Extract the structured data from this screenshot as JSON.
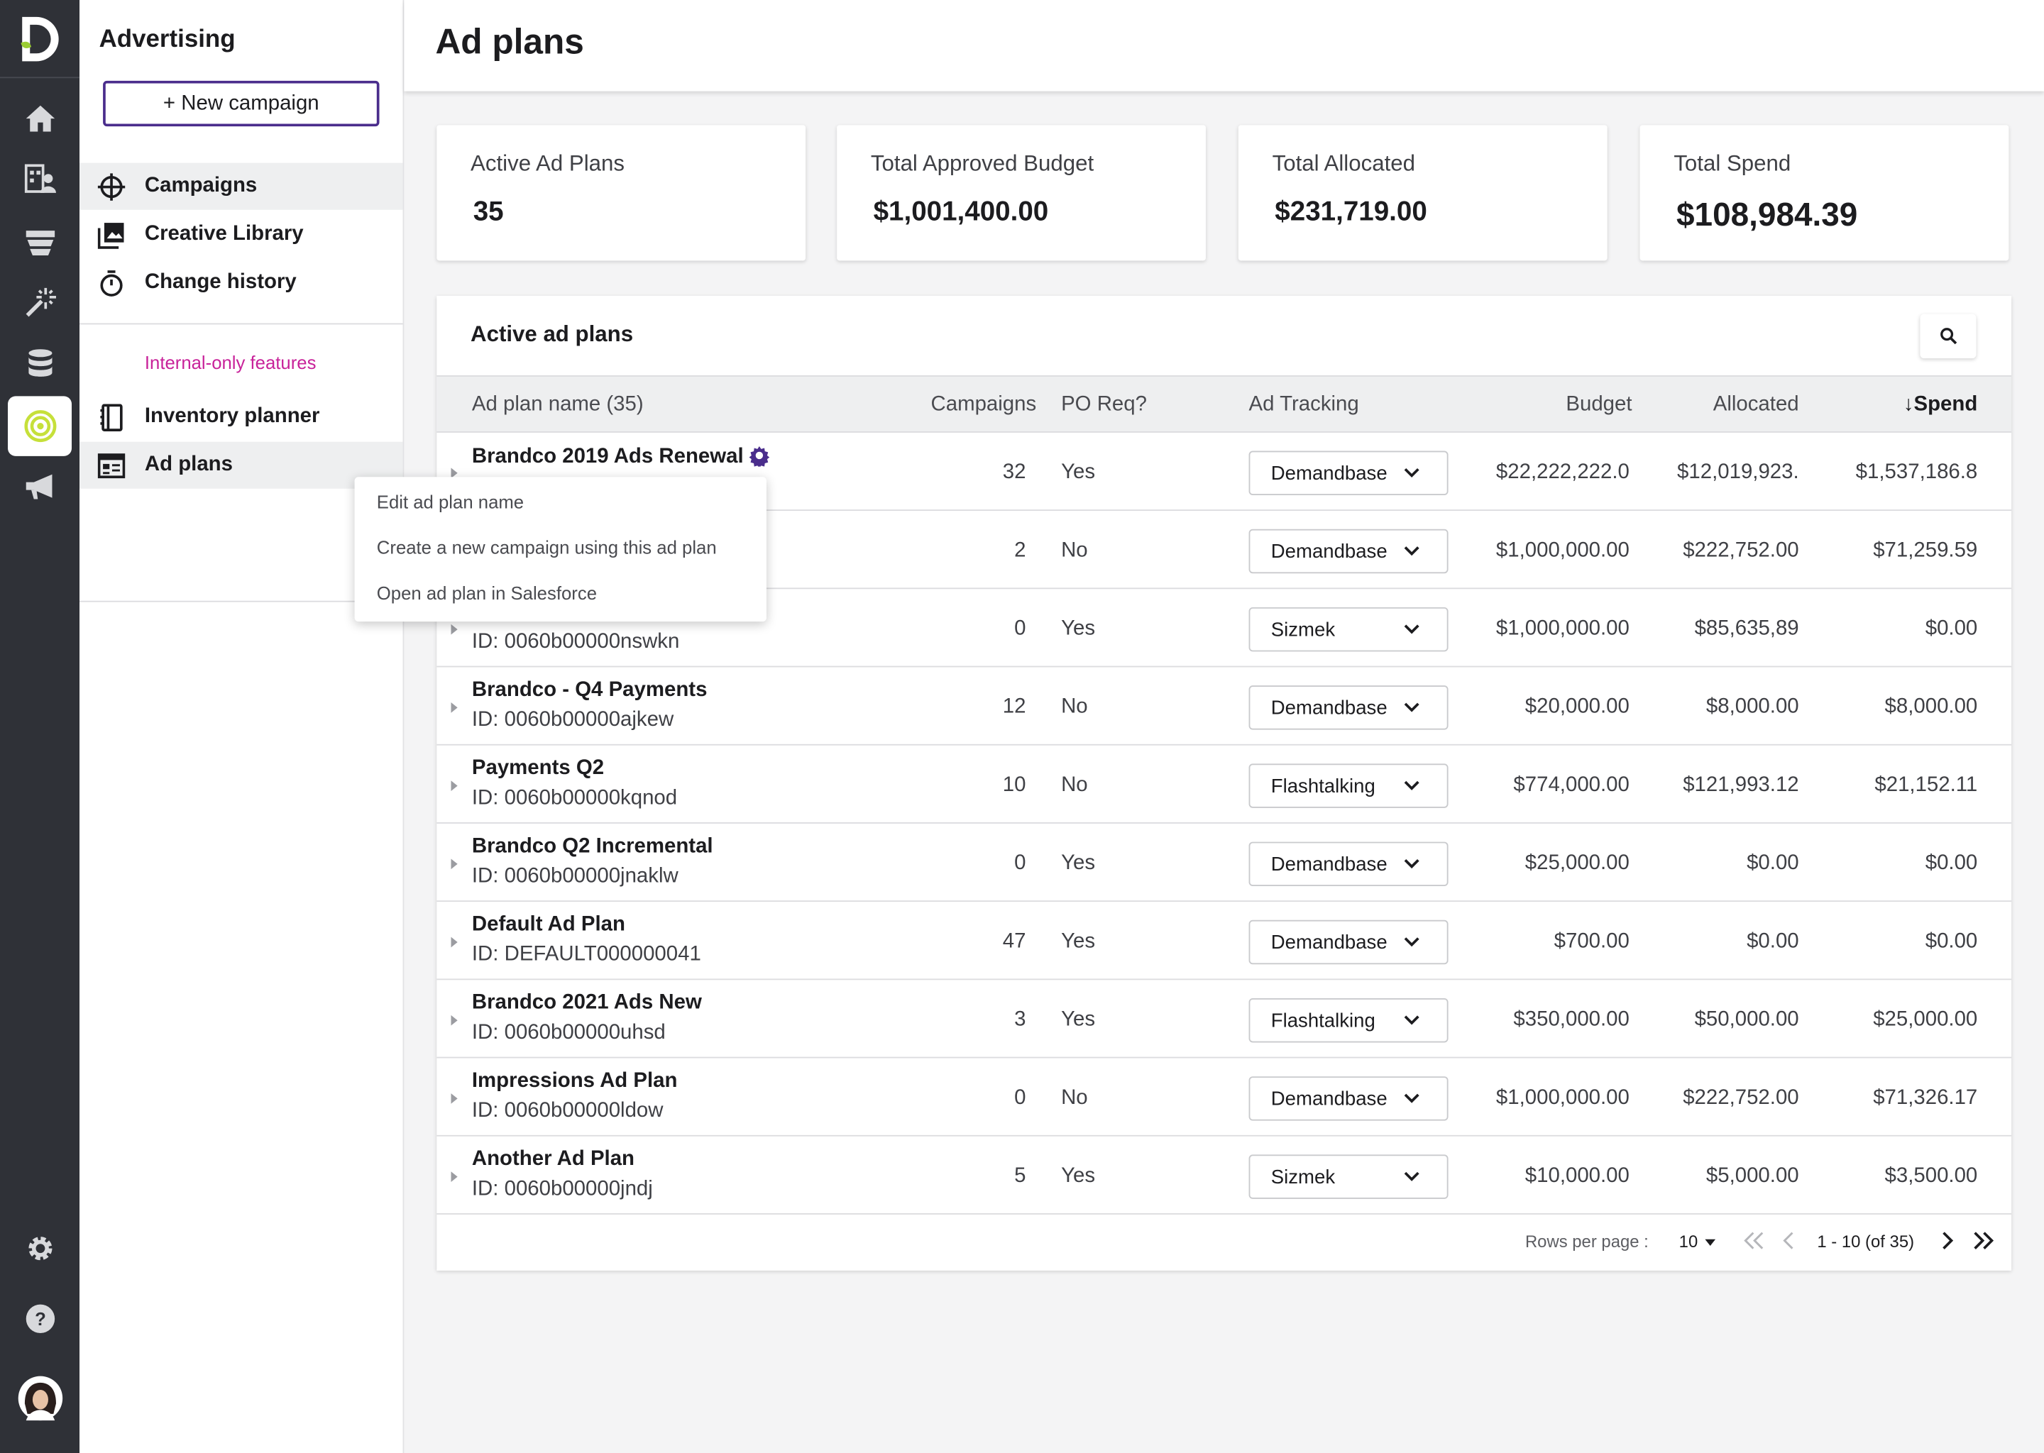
{
  "subnav": {
    "title": "Advertising",
    "new_campaign_label": "+ New campaign",
    "items": [
      {
        "label": "Campaigns",
        "icon": "crosshair-icon"
      },
      {
        "label": "Creative Library",
        "icon": "image-library-icon"
      },
      {
        "label": "Change history",
        "icon": "stopwatch-icon"
      }
    ],
    "internal_label": "Internal-only features",
    "internal_items": [
      {
        "label": "Inventory planner",
        "icon": "notebook-icon"
      },
      {
        "label": "Ad plans",
        "icon": "calendar-board-icon"
      }
    ]
  },
  "rail": {
    "icons": [
      "home-icon",
      "building-person-icon",
      "layers-icon",
      "magic-wand-icon",
      "database-icon",
      "target-icon",
      "megaphone-icon",
      "gear-icon",
      "help-icon",
      "avatar"
    ],
    "active": "target-icon"
  },
  "header": {
    "title": "Ad plans"
  },
  "stats": [
    {
      "label": "Active Ad Plans",
      "value": "35"
    },
    {
      "label": "Total Approved Budget",
      "value": "$1,001,400.00"
    },
    {
      "label": "Total Allocated",
      "value": "$231,719.00"
    },
    {
      "label": "Total Spend",
      "value": "$108,984.39"
    }
  ],
  "table": {
    "title": "Active ad plans",
    "columns": [
      "Ad plan name (35)",
      "Campaigns",
      "PO Req?",
      "Ad Tracking",
      "Budget",
      "Allocated",
      "↓Spend"
    ],
    "rows": [
      {
        "name": "Brandco 2019 Ads Renewal",
        "id": "",
        "campaigns": "32",
        "po": "Yes",
        "tracking": "Demandbase",
        "budget": "$22,222,222.0",
        "allocated": "$12,019,923.",
        "spend": "$1,537,186.8"
      },
      {
        "name": "",
        "id": "",
        "campaigns": "2",
        "po": "No",
        "tracking": "Demandbase",
        "budget": "$1,000,000.00",
        "allocated": "$222,752.00",
        "spend": "$71,259.59"
      },
      {
        "name": "",
        "id": "ID: 0060b00000nswkn",
        "campaigns": "0",
        "po": "Yes",
        "tracking": "Sizmek",
        "budget": "$1,000,000.00",
        "allocated": "$85,635,89",
        "spend": "$0.00"
      },
      {
        "name": "Brandco - Q4 Payments",
        "id": "ID: 0060b00000ajkew",
        "campaigns": "12",
        "po": "No",
        "tracking": "Demandbase",
        "budget": "$20,000.00",
        "allocated": "$8,000.00",
        "spend": "$8,000.00"
      },
      {
        "name": "Payments Q2",
        "id": "ID: 0060b00000kqnod",
        "campaigns": "10",
        "po": "No",
        "tracking": "Flashtalking",
        "budget": "$774,000.00",
        "allocated": "$121,993.12",
        "spend": "$21,152.11"
      },
      {
        "name": "Brandco Q2 Incremental",
        "id": "ID: 0060b00000jnaklw",
        "campaigns": "0",
        "po": "Yes",
        "tracking": "Demandbase",
        "budget": "$25,000.00",
        "allocated": "$0.00",
        "spend": "$0.00"
      },
      {
        "name": "Default Ad Plan",
        "id": "ID: DEFAULT000000041",
        "campaigns": "47",
        "po": "Yes",
        "tracking": "Demandbase",
        "budget": "$700.00",
        "allocated": "$0.00",
        "spend": "$0.00"
      },
      {
        "name": "Brandco 2021 Ads New",
        "id": "ID: 0060b00000uhsd",
        "campaigns": "3",
        "po": "Yes",
        "tracking": "Flashtalking",
        "budget": "$350,000.00",
        "allocated": "$50,000.00",
        "spend": "$25,000.00"
      },
      {
        "name": "Impressions Ad Plan",
        "id": "ID: 0060b00000ldow",
        "campaigns": "0",
        "po": "No",
        "tracking": "Demandbase",
        "budget": "$1,000,000.00",
        "allocated": "$222,752.00",
        "spend": "$71,326.17"
      },
      {
        "name": "Another Ad Plan",
        "id": "ID: 0060b00000jndj",
        "campaigns": "5",
        "po": "Yes",
        "tracking": "Sizmek",
        "budget": "$10,000.00",
        "allocated": "$5,000.00",
        "spend": "$3,500.00"
      }
    ]
  },
  "pagination": {
    "rows_per_page_label": "Rows per page :",
    "rows_per_page": "10",
    "range": "1 - 10 (of 35)"
  },
  "context_menu": {
    "items": [
      "Edit ad plan name",
      "Create a new campaign using this ad plan",
      "Open ad plan in Salesforce"
    ]
  },
  "colors": {
    "rail": "#2f3137",
    "accent_purple": "#4a2d8c",
    "internal_pink": "#c8239a",
    "target_green": "#c6e03a"
  }
}
